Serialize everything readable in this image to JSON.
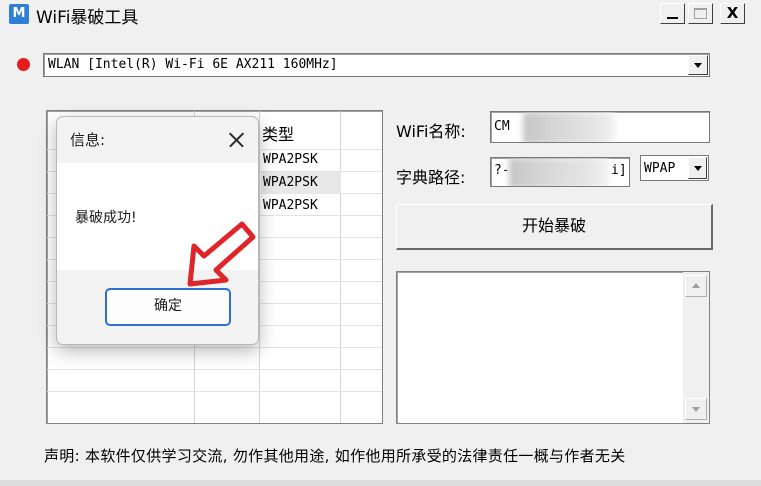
{
  "window": {
    "icon_letter": "M",
    "title": "WiFi暴破工具",
    "minimize": "_",
    "maximize": "□",
    "close": "X"
  },
  "adapter": {
    "status_color": "#e31c1c",
    "selected": "WLAN [Intel(R) Wi-Fi 6E AX211 160MHz]"
  },
  "wifi_list": {
    "columns": [
      "类型"
    ],
    "rows": [
      {
        "type": "WPA2PSK"
      },
      {
        "type": "WPA2PSK"
      },
      {
        "type": "WPA2PSK"
      }
    ]
  },
  "form": {
    "ssid_label": "WiFi名称:",
    "ssid_value": "CM",
    "dict_label": "字典路径:",
    "dict_value_start": "?-",
    "dict_value_end": "i]",
    "auth_selected": "WPAP",
    "start_button": "开始暴破"
  },
  "log": {
    "text": ""
  },
  "disclaimer": "声明: 本软件仅供学习交流, 勿作其他用途, 如作他用所承受的法律责任一概与作者无关",
  "dialog": {
    "title": "信息:",
    "message": "暴破成功!",
    "ok_button": "确定"
  },
  "annotation": {
    "arrow_color": "#e0252a"
  }
}
